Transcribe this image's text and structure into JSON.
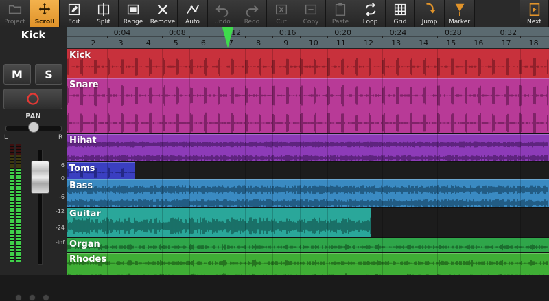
{
  "toolbar": {
    "buttons": [
      {
        "label": "Project",
        "icon": "folder-icon",
        "state": "disabled"
      },
      {
        "label": "Scroll",
        "icon": "move-arrows-icon",
        "state": "active"
      },
      {
        "label": "Edit",
        "icon": "pencil-icon",
        "state": "normal"
      },
      {
        "label": "Split",
        "icon": "split-icon",
        "state": "normal"
      },
      {
        "label": "Range",
        "icon": "range-icon",
        "state": "normal"
      },
      {
        "label": "Remove",
        "icon": "remove-x-icon",
        "state": "normal"
      },
      {
        "label": "Auto",
        "icon": "automation-icon",
        "state": "normal"
      },
      {
        "label": "Undo",
        "icon": "undo-icon",
        "state": "disabled"
      },
      {
        "label": "Redo",
        "icon": "redo-icon",
        "state": "disabled"
      },
      {
        "label": "Cut",
        "icon": "cut-icon",
        "state": "disabled"
      },
      {
        "label": "Copy",
        "icon": "copy-icon",
        "state": "disabled"
      },
      {
        "label": "Paste",
        "icon": "paste-icon",
        "state": "disabled"
      },
      {
        "label": "Loop",
        "icon": "loop-icon",
        "state": "normal"
      },
      {
        "label": "Grid",
        "icon": "grid-icon",
        "state": "normal"
      },
      {
        "label": "Jump",
        "icon": "jump-icon",
        "state": "normal"
      },
      {
        "label": "Marker",
        "icon": "marker-icon",
        "state": "normal"
      },
      {
        "label": "Next",
        "icon": "next-page-icon",
        "state": "normal"
      }
    ]
  },
  "mixer": {
    "track_name": "Kick",
    "mute_label": "M",
    "solo_label": "S",
    "record_icon": "record-circle-icon",
    "pan_label": "PAN",
    "pan_left": "L",
    "pan_right": "R",
    "pan_value": 0.5,
    "fader_level": 0.87,
    "db_scale": [
      "6",
      "0",
      "-6",
      "-12",
      "-24",
      "-inf"
    ]
  },
  "ruler": {
    "times": [
      "0:04",
      "0:08",
      "0:12",
      "0:16",
      "0:20",
      "0:24",
      "0:28",
      "0:32"
    ],
    "bars": [
      "2",
      "3",
      "4",
      "5",
      "6",
      "7",
      "8",
      "9",
      "10",
      "11",
      "12",
      "13",
      "14",
      "15",
      "16",
      "17",
      "18"
    ],
    "playhead_bar": 6.9,
    "cursor_bar": 9.2
  },
  "tracks": [
    {
      "name": "Kick",
      "color": "#c8313c",
      "wave_color": "#6b1520",
      "clip_end_bar": 19.5
    },
    {
      "name": "Snare",
      "color": "#b83a97",
      "wave_color": "#5a1449",
      "clip_end_bar": 19.5
    },
    {
      "name": "Hihat",
      "color": "#8d3bb8",
      "wave_color": "#3f1459",
      "clip_end_bar": 19.5
    },
    {
      "name": "Toms",
      "color": "#3a3fc1",
      "wave_color": "#161a60",
      "clip_end_bar": 3.5
    },
    {
      "name": "Bass",
      "color": "#3a8ac2",
      "wave_color": "#123e5c",
      "clip_end_bar": 19.5
    },
    {
      "name": "Guitar",
      "color": "#2aa79a",
      "wave_color": "#0f4d46",
      "clip_end_bar": 12.1
    },
    {
      "name": "Organ",
      "color": "#2fa64a",
      "wave_color": "#114a1e",
      "clip_end_bar": 19.5
    },
    {
      "name": "Rhodes",
      "color": "#3fae35",
      "wave_color": "#154d12",
      "clip_end_bar": 19.5
    }
  ]
}
